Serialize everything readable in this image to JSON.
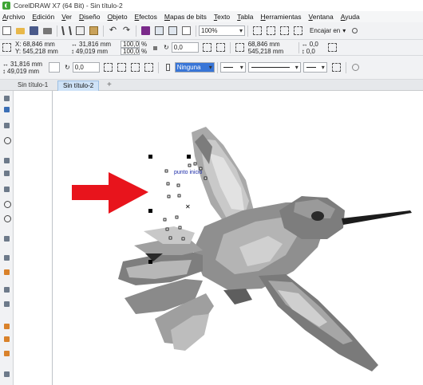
{
  "window": {
    "title": "CorelDRAW X7 (64 Bit) - Sin título-2"
  },
  "menu": [
    "Archivo",
    "Edición",
    "Ver",
    "Diseño",
    "Objeto",
    "Efectos",
    "Mapas de bits",
    "Texto",
    "Tabla",
    "Herramientas",
    "Ventana",
    "Ayuda"
  ],
  "toolbar1": {
    "zoom": "100%",
    "snap_label": "Encajar en"
  },
  "toolbar2": {
    "x": "X: 68,846 mm",
    "y": "Y: 545,218 mm",
    "w": "31,816 mm",
    "h": "49,019 mm",
    "scale_w": "100,0",
    "scale_h": "100,0",
    "pct": "%",
    "rotation": "0,0",
    "x2": "68,846 mm",
    "y2": "545,218 mm",
    "nudge1": "0,0",
    "nudge2": "0,0"
  },
  "toolbar3": {
    "w": "31,816 mm",
    "h": "49,019 mm",
    "rotation": "0,0",
    "fill": "Ninguna"
  },
  "tabs": [
    {
      "label": "Sin título-1",
      "active": false
    },
    {
      "label": "Sin título-2",
      "active": true
    }
  ],
  "canvas": {
    "node_label": "punto inicio"
  },
  "colors": {
    "accent_arrow": "#e8141c",
    "selection": "#3875d7"
  }
}
